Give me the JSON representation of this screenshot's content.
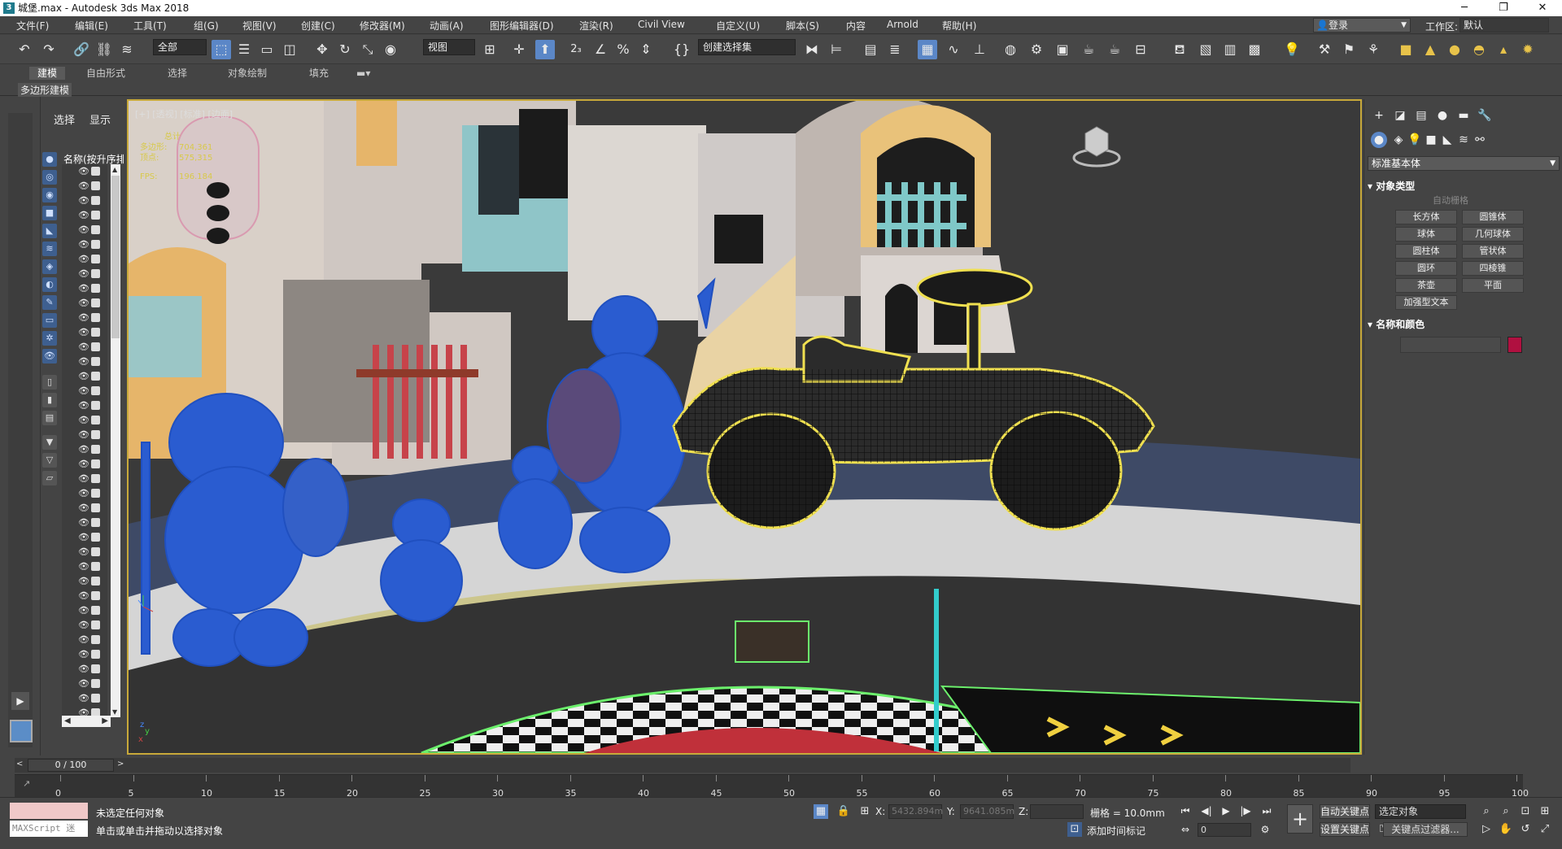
{
  "window": {
    "title": "城堡.max - Autodesk 3ds Max 2018",
    "app_icon": "3",
    "controls": [
      "─",
      "❐",
      "✕"
    ]
  },
  "menu": [
    "文件(F)",
    "编辑(E)",
    "工具(T)",
    "组(G)",
    "视图(V)",
    "创建(C)",
    "修改器(M)",
    "动画(A)",
    "图形编辑器(D)",
    "渲染(R)",
    "Civil View",
    "自定义(U)",
    "脚本(S)",
    "内容",
    "Arnold",
    "帮助(H)"
  ],
  "account": {
    "login": "登录",
    "workspace_label": "工作区:",
    "workspace_value": "默认"
  },
  "toolbar": {
    "filter_value": "全部",
    "refcoord_value": "视图",
    "selection_set_placeholder": "创建选择集",
    "spinner_label": "2₃"
  },
  "ribbon": {
    "tabs": [
      "建模",
      "自由形式",
      "选择",
      "对象绘制",
      "填充"
    ],
    "active_tab": "建模",
    "sub_label": "多边形建模"
  },
  "explorer": {
    "tabs": [
      "选择",
      "显示"
    ],
    "name_header": "名称(按升序排序)"
  },
  "viewport": {
    "label": "[+] [透视] [标准] [边面]",
    "stats": {
      "header": "总计",
      "polys_label": "多边形:",
      "polys_value": "704,361",
      "verts_label": "顶点:",
      "verts_value": "575,315",
      "fps_label": "FPS:",
      "fps_value": "196.184"
    },
    "axis": {
      "x": "x",
      "y": "y",
      "z": "z"
    }
  },
  "command_panel": {
    "dropdown": "标准基本体",
    "object_type_title": "对象类型",
    "auto_grid": "自动栅格",
    "buttons": [
      "长方体",
      "圆锥体",
      "球体",
      "几何球体",
      "圆柱体",
      "管状体",
      "圆环",
      "四棱锥",
      "茶壶",
      "平面",
      "加强型文本"
    ],
    "name_color_title": "名称和颜色",
    "object_color": "#b01040"
  },
  "timeline": {
    "frame_display": "0 / 100",
    "ticks": [
      "0",
      "5",
      "10",
      "15",
      "20",
      "25",
      "30",
      "35",
      "40",
      "45",
      "50",
      "55",
      "60",
      "65",
      "70",
      "75",
      "80",
      "85",
      "90",
      "95",
      "100"
    ]
  },
  "status": {
    "maxscript_label": "MAXScript 迷",
    "line1": "未选定任何对象",
    "line2": "单击或单击并拖动以选择对象",
    "x_label": "X:",
    "x_value": "5432.894m",
    "y_label": "Y:",
    "y_value": "9641.085m",
    "z_label": "Z:",
    "z_value": "",
    "grid": "栅格 = 10.0mm",
    "add_time_tag": "添加时间标记",
    "frame_value": "0",
    "auto_key": "自动关键点",
    "set_key": "设置关键点",
    "selection_set": "选定对象",
    "key_filters": "关键点过滤器..."
  }
}
